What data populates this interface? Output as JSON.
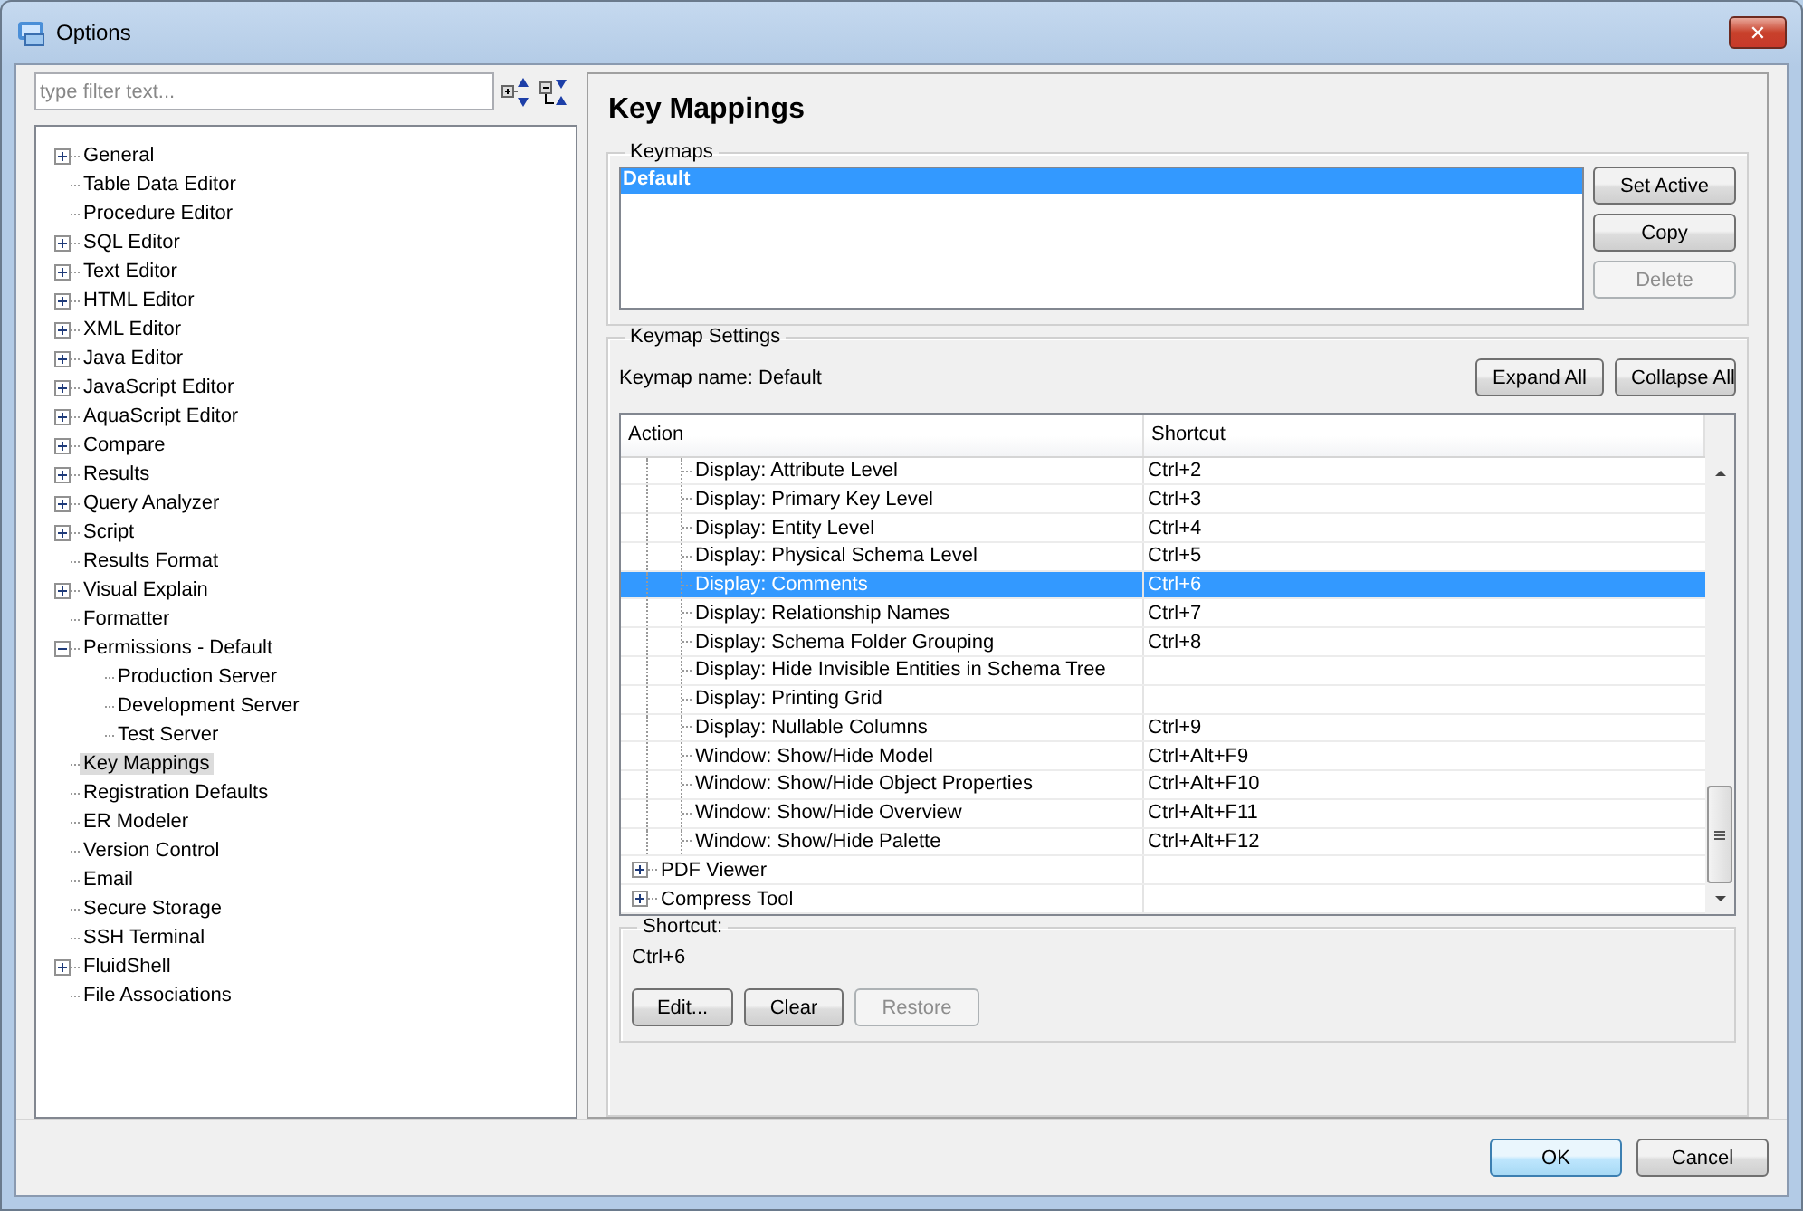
{
  "window": {
    "title": "Options",
    "close": "✕"
  },
  "filter": {
    "placeholder": "type filter text..."
  },
  "nav_tree": [
    {
      "label": "General",
      "expanded": false,
      "selected": false
    },
    {
      "label": "Table Data Editor",
      "selected": false
    },
    {
      "label": "Procedure Editor",
      "selected": false
    },
    {
      "label": "SQL Editor",
      "expanded": false,
      "selected": false
    },
    {
      "label": "Text Editor",
      "expanded": false,
      "selected": false
    },
    {
      "label": "HTML Editor",
      "expanded": false,
      "selected": false
    },
    {
      "label": "XML Editor",
      "expanded": false,
      "selected": false
    },
    {
      "label": "Java Editor",
      "expanded": false,
      "selected": false
    },
    {
      "label": "JavaScript Editor",
      "expanded": false,
      "selected": false
    },
    {
      "label": "AquaScript Editor",
      "expanded": false,
      "selected": false
    },
    {
      "label": "Compare",
      "expanded": false,
      "selected": false
    },
    {
      "label": "Results",
      "expanded": false,
      "selected": false
    },
    {
      "label": "Query Analyzer",
      "expanded": false,
      "selected": false
    },
    {
      "label": "Script",
      "expanded": false,
      "selected": false
    },
    {
      "label": "Results Format",
      "selected": false
    },
    {
      "label": "Visual Explain",
      "expanded": false,
      "selected": false
    },
    {
      "label": "Formatter",
      "selected": false
    },
    {
      "label": "Permissions - Default",
      "expanded": true,
      "selected": false,
      "children": [
        {
          "label": "Production Server",
          "selected": false
        },
        {
          "label": "Development Server",
          "selected": false
        },
        {
          "label": "Test Server",
          "selected": false
        }
      ]
    },
    {
      "label": "Key Mappings",
      "selected": true
    },
    {
      "label": "Registration Defaults",
      "selected": false
    },
    {
      "label": "ER Modeler",
      "selected": false
    },
    {
      "label": "Version Control",
      "selected": false
    },
    {
      "label": "Email",
      "selected": false
    },
    {
      "label": "Secure Storage",
      "selected": false
    },
    {
      "label": "SSH Terminal",
      "selected": false
    },
    {
      "label": "FluidShell",
      "expanded": false,
      "selected": false
    },
    {
      "label": "File Associations",
      "selected": false
    }
  ],
  "page": {
    "title": "Key Mappings",
    "keymaps": {
      "legend": "Keymaps",
      "items": [
        {
          "label": "Default",
          "selected": true
        }
      ],
      "buttons": [
        {
          "label": "Set Active",
          "disabled": false
        },
        {
          "label": "Copy",
          "disabled": false
        },
        {
          "label": "Delete",
          "disabled": true
        }
      ]
    },
    "settings": {
      "legend": "Keymap Settings",
      "keymap_name": "Keymap name: Default",
      "buttons": [
        {
          "label": "Expand All"
        },
        {
          "label": "Collapse All"
        }
      ],
      "table": {
        "columns": [
          "Action",
          "Shortcut"
        ],
        "rows": [
          {
            "children": [
              {
                "action": "Display: Attribute Level",
                "shortcut": "Ctrl+2",
                "selected": false
              },
              {
                "action": "Display: Primary Key Level",
                "shortcut": "Ctrl+3",
                "selected": false
              },
              {
                "action": "Display: Entity Level",
                "shortcut": "Ctrl+4",
                "selected": false
              },
              {
                "action": "Display: Physical Schema Level",
                "shortcut": "Ctrl+5",
                "selected": false
              },
              {
                "action": "Display: Comments",
                "shortcut": "Ctrl+6",
                "selected": true
              },
              {
                "action": "Display: Relationship Names",
                "shortcut": "Ctrl+7",
                "selected": false
              },
              {
                "action": "Display: Schema Folder Grouping",
                "shortcut": "Ctrl+8",
                "selected": false
              },
              {
                "action": "Display: Hide Invisible Entities in Schema Tree",
                "selected": false
              },
              {
                "action": "Display: Printing Grid",
                "selected": false
              },
              {
                "action": "Display: Nullable Columns",
                "shortcut": "Ctrl+9",
                "selected": false
              },
              {
                "action": "Window: Show/Hide Model",
                "shortcut": "Ctrl+Alt+F9",
                "selected": false
              },
              {
                "action": "Window: Show/Hide Object Properties",
                "shortcut": "Ctrl+Alt+F10",
                "selected": false
              },
              {
                "action": "Window: Show/Hide Overview",
                "shortcut": "Ctrl+Alt+F11",
                "selected": false
              },
              {
                "action": "Window: Show/Hide Palette",
                "shortcut": "Ctrl+Alt+F12",
                "selected": false
              }
            ]
          },
          {
            "action": "PDF Viewer",
            "expanded": false,
            "selected": false
          },
          {
            "action": "Compress Tool",
            "expanded": false,
            "selected": false
          }
        ]
      },
      "shortcut": {
        "legend": "Shortcut:",
        "value": "Ctrl+6",
        "buttons": [
          {
            "label": "Edit...",
            "disabled": false
          },
          {
            "label": "Clear",
            "disabled": false
          },
          {
            "label": "Restore",
            "disabled": true
          }
        ]
      }
    }
  },
  "footer_buttons": [
    {
      "label": "OK",
      "default": true
    },
    {
      "label": "Cancel",
      "default": false
    }
  ]
}
